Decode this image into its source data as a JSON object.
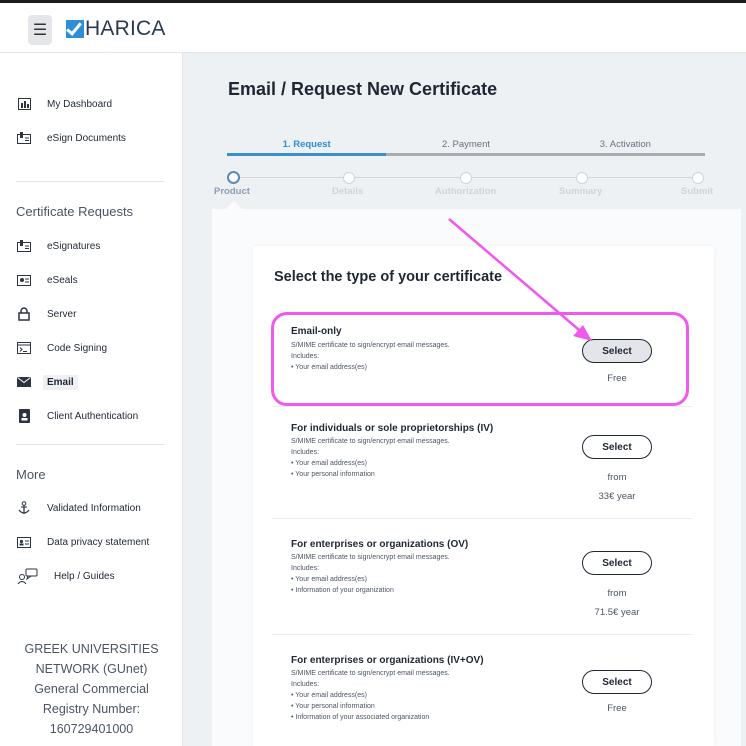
{
  "header": {
    "menu_icon": "☰",
    "logo_text": "HARICA"
  },
  "sidebar": {
    "items": [
      {
        "label": "My Dashboard",
        "icon": "dashboard-icon"
      },
      {
        "label": "eSign Documents",
        "icon": "document-sign-icon"
      }
    ],
    "cert_section_title": "Certificate Requests",
    "cert_items": [
      {
        "label": "eSignatures",
        "icon": "signature-icon"
      },
      {
        "label": "eSeals",
        "icon": "seal-icon"
      },
      {
        "label": "Server",
        "icon": "lock-icon"
      },
      {
        "label": "Code Signing",
        "icon": "code-icon"
      },
      {
        "label": "Email",
        "icon": "email-icon",
        "active": true
      },
      {
        "label": "Client Authentication",
        "icon": "badge-icon"
      }
    ],
    "more_title": "More",
    "more_items": [
      {
        "label": "Validated Information",
        "icon": "anchor-icon"
      },
      {
        "label": "Data privacy statement",
        "icon": "id-card-icon"
      },
      {
        "label": "Help / Guides",
        "icon": "help-chat-icon"
      }
    ],
    "footer_lines": [
      "GREEK UNIVERSITIES",
      "NETWORK (GUnet)",
      "General Commercial",
      "Registry Number:",
      "160729401000"
    ]
  },
  "main": {
    "title": "Email / Request New Certificate",
    "steps": [
      "1. Request",
      "2. Payment",
      "3. Activation"
    ],
    "current_step": 0,
    "substeps": [
      "Product",
      "Details",
      "Authorization",
      "Summary",
      "Submit"
    ],
    "card_title": "Select the type of your certificate",
    "options": [
      {
        "name": "Email-only",
        "desc": [
          "S/MIME certificate to sign/encrypt email messages.",
          "Includes:",
          "• Your email address(es)"
        ],
        "button": "Select",
        "price": [
          "Free"
        ]
      },
      {
        "name": "For individuals or sole proprietorships (IV)",
        "desc": [
          "S/MIME certificate to sign/encrypt email messages.",
          "Includes:",
          "• Your email address(es)",
          "• Your personal information"
        ],
        "button": "Select",
        "price": [
          "from",
          "33€ year"
        ]
      },
      {
        "name": "For enterprises or organizations (OV)",
        "desc": [
          "S/MIME certificate to sign/encrypt email messages.",
          "Includes:",
          "• Your email address(es)",
          "• Information of your organization"
        ],
        "button": "Select",
        "price": [
          "from",
          "71.5€ year"
        ]
      },
      {
        "name": "For enterprises or organizations (IV+OV)",
        "desc": [
          "S/MIME certificate to sign/encrypt email messages.",
          "Includes:",
          "• Your email address(es)",
          "• Your personal information",
          "• Information of your associated organization"
        ],
        "button": "Select",
        "price": [
          "Free"
        ]
      }
    ]
  },
  "colors": {
    "accent": "#2d8fd6",
    "highlight": "#f158ef",
    "step_done": "#3a8ecb"
  }
}
